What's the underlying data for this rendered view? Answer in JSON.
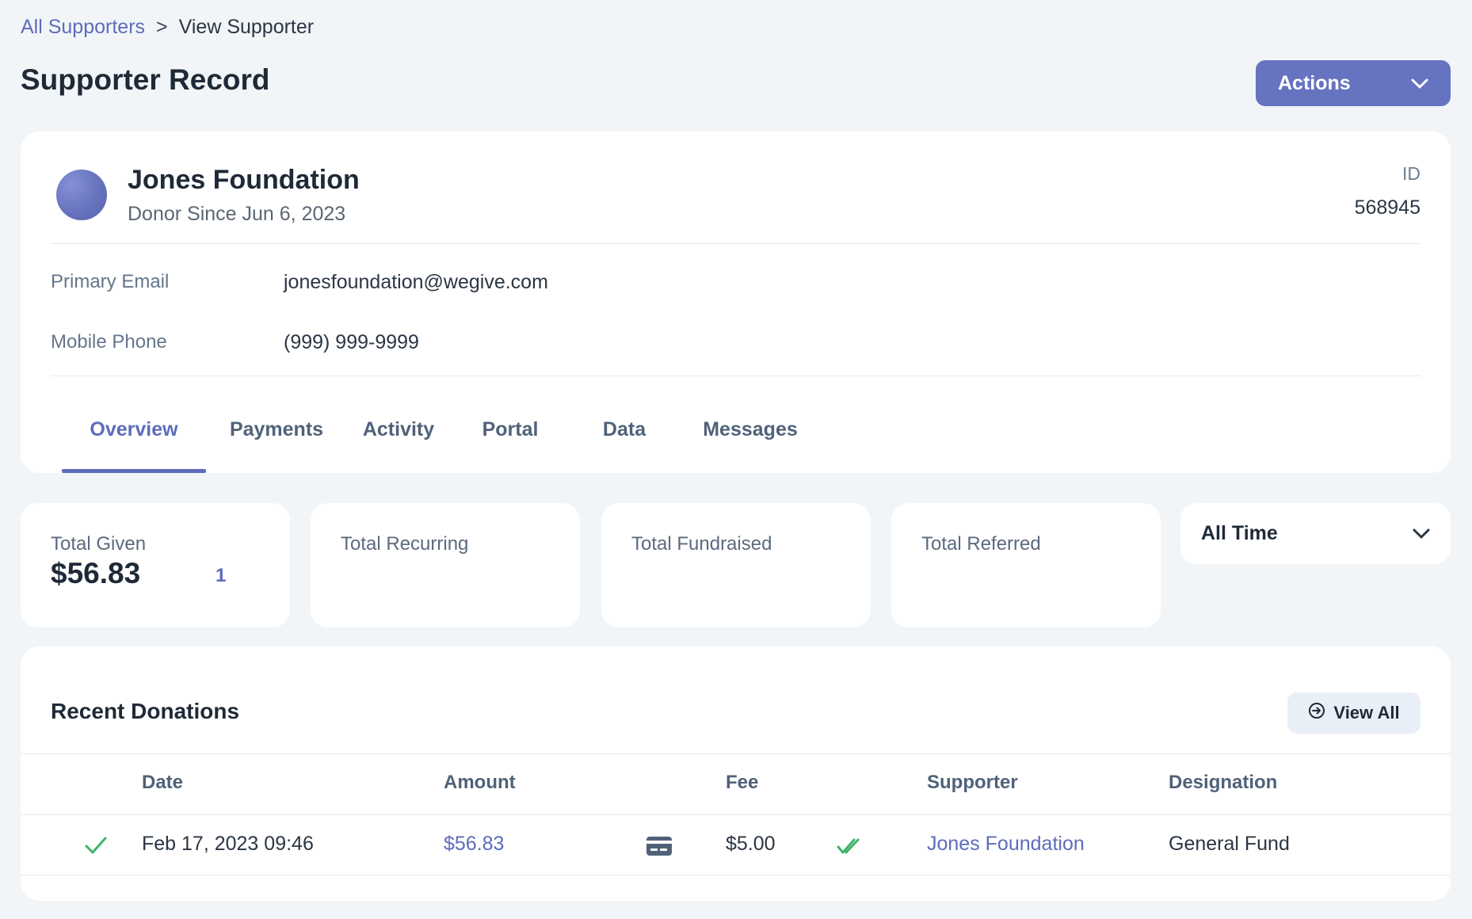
{
  "breadcrumb": {
    "parent": "All Supporters",
    "separator": ">",
    "current": "View Supporter"
  },
  "header": {
    "title": "Supporter Record",
    "actions_label": "Actions"
  },
  "profile": {
    "name": "Jones Foundation",
    "donor_since": "Donor Since Jun 6, 2023",
    "id_label": "ID",
    "id_value": "568945",
    "fields": {
      "email_label": "Primary Email",
      "email_value": "jonesfoundation@wegive.com",
      "phone_label": "Mobile Phone",
      "phone_value": "(999) 999-9999"
    },
    "tabs": [
      {
        "label": "Overview",
        "active": true
      },
      {
        "label": "Payments"
      },
      {
        "label": "Activity"
      },
      {
        "label": "Portal"
      },
      {
        "label": "Data"
      },
      {
        "label": "Messages"
      }
    ]
  },
  "stats": {
    "total_given_label": "Total Given",
    "total_given_value": "$56.83",
    "total_given_count": "1",
    "total_recurring_label": "Total Recurring",
    "total_fundraised_label": "Total Fundraised",
    "total_referred_label": "Total Referred",
    "period_value": "All Time"
  },
  "donations": {
    "title": "Recent Donations",
    "view_all_label": "View All",
    "columns": {
      "date": "Date",
      "amount": "Amount",
      "fee": "Fee",
      "supporter": "Supporter",
      "designation": "Designation"
    },
    "rows": [
      {
        "date": "Feb 17, 2023 09:46",
        "amount": "$56.83",
        "fee": "$5.00",
        "supporter": "Jones Foundation",
        "designation": "General Fund"
      }
    ]
  },
  "colors": {
    "accent": "#5d6cbb",
    "button": "#6673c0",
    "success": "#3fb46b",
    "background": "#f2f5f8"
  }
}
